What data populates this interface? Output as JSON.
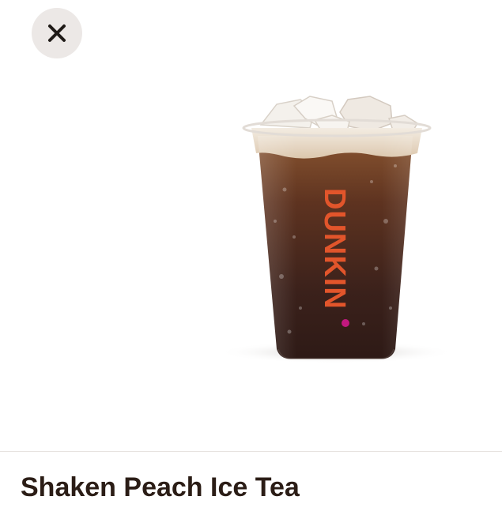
{
  "close_button": {
    "icon": "close-icon"
  },
  "product": {
    "name": "Shaken Peach Ice Tea",
    "image": {
      "subject": "iced tea cup",
      "brand_mark": "DUNKIN'"
    }
  },
  "colors": {
    "close_bg": "#ece8e6",
    "title_text": "#2b1d16",
    "brand_orange": "#e2552b",
    "brand_pink": "#c2187f"
  }
}
